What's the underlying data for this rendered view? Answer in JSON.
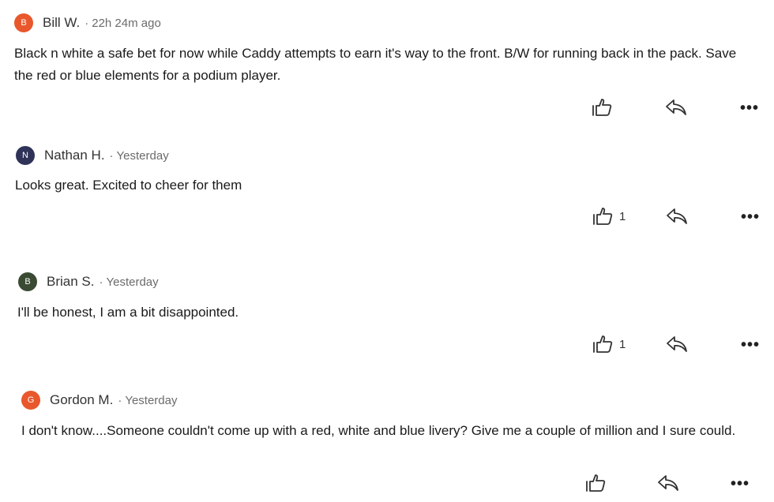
{
  "comments": [
    {
      "initial": "B",
      "avatar_color": "#e8582c",
      "author": "Bill W.",
      "separator": "·",
      "time": "22h 24m ago",
      "text": "Black n white a safe bet for now while Caddy attempts to earn it's way to the front. B/W for running back in the pack. Save the red or blue elements for a podium player.",
      "likes": ""
    },
    {
      "initial": "N",
      "avatar_color": "#2f3358",
      "author": "Nathan H.",
      "separator": "·",
      "time": "Yesterday",
      "text": "Looks great. Excited to cheer for them",
      "likes": "1"
    },
    {
      "initial": "B",
      "avatar_color": "#3a4a33",
      "author": "Brian S.",
      "separator": "·",
      "time": "Yesterday",
      "text": "I'll be honest, I am a bit disappointed.",
      "likes": "1"
    },
    {
      "initial": "G",
      "avatar_color": "#e8582c",
      "author": "Gordon M.",
      "separator": "·",
      "time": "Yesterday",
      "text": "I don't know....Someone couldn't come up with a red, white and blue livery? Give me a couple of million and I sure could.",
      "likes": ""
    }
  ],
  "icons": {
    "like": "thumbs-up-icon",
    "reply": "reply-icon",
    "more": "more-options-icon"
  },
  "more_glyph": "•••"
}
